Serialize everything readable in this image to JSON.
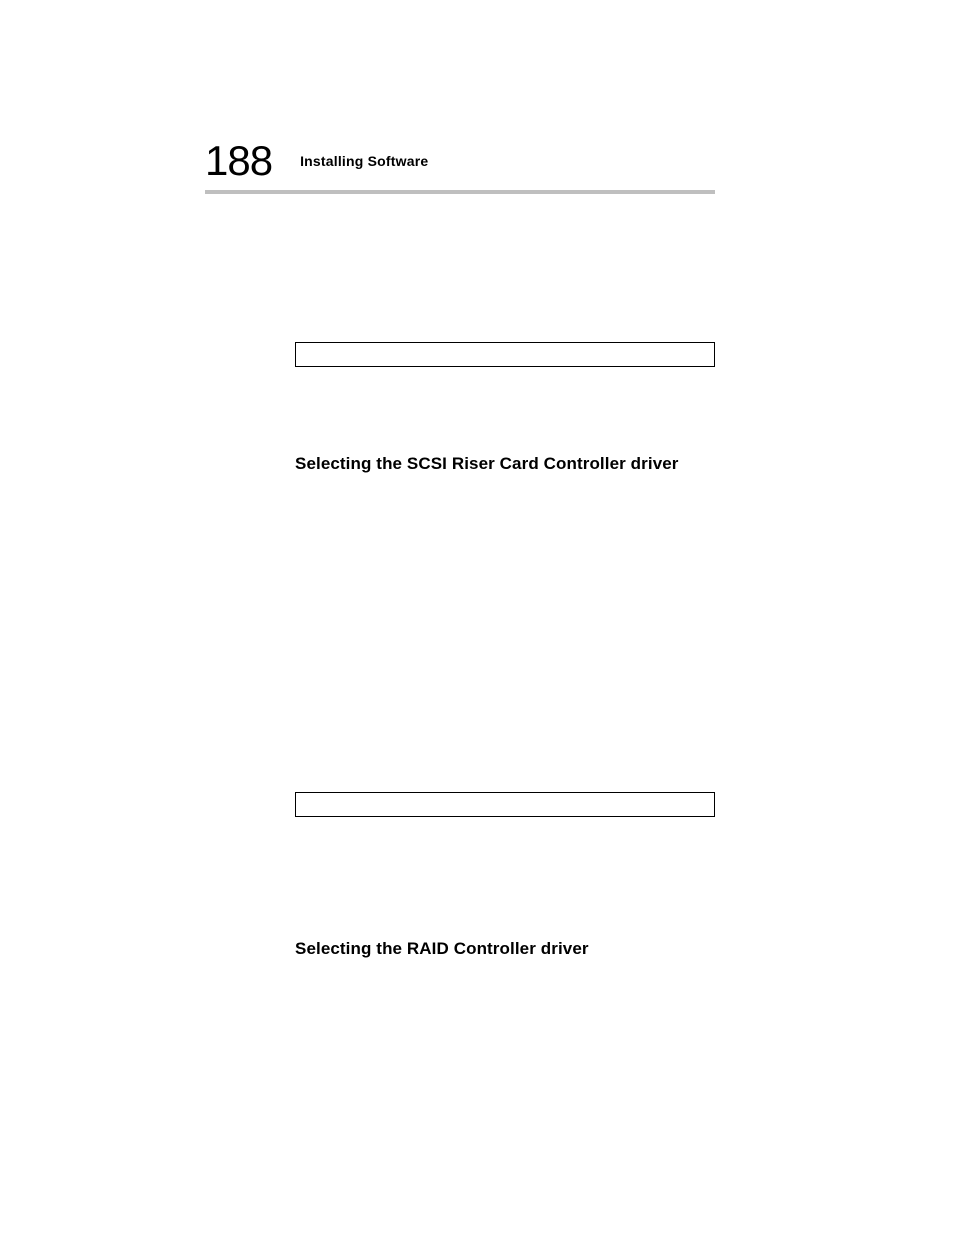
{
  "header": {
    "page_number": "188",
    "chapter_title": "Installing Software"
  },
  "sections": {
    "scsi_heading": "Selecting the SCSI Riser Card Controller driver",
    "raid_heading": "Selecting the RAID Controller driver"
  }
}
